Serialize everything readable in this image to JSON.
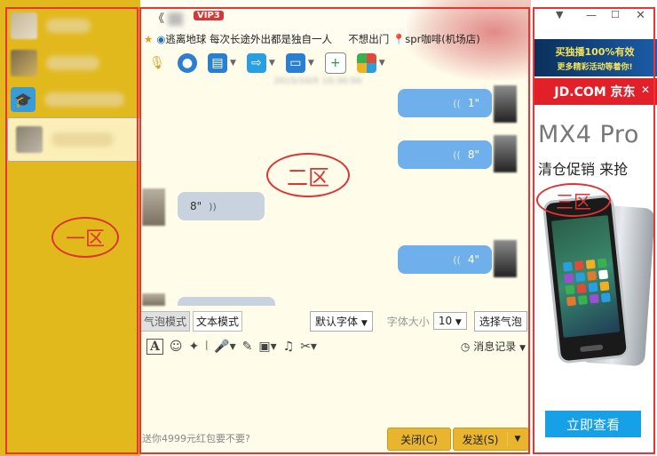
{
  "zone_labels": {
    "zone1": "一区",
    "zone2": "二区",
    "zone3": "三区"
  },
  "chat": {
    "vip_badge": "VIP3",
    "status_line": "逃离地球 每次长途外出都是独自一人",
    "status_extra": "不想出门",
    "location": "spr咖啡(机场店)",
    "messages": [
      {
        "side": "right",
        "duration": "1\""
      },
      {
        "side": "right",
        "duration": "8\""
      },
      {
        "side": "left",
        "duration": "8\""
      },
      {
        "side": "right",
        "duration": "4\""
      }
    ],
    "mode_tabs": {
      "bubble": "气泡模式",
      "text": "文本模式"
    },
    "font_select": "默认字体",
    "font_size_label": "字体大小",
    "font_size_value": "10",
    "choose_bubble": "选择气泡",
    "history": "消息记录",
    "input_hint": "送你4999元红包要不要?",
    "close_button": "关闭(C)",
    "send_button": "发送(S)"
  },
  "ad": {
    "top_banner_line1": "买独播100%有效",
    "top_banner_line2": "更多精彩活动等着你!",
    "jd_brand": "JD.COM 京东",
    "model": "MX4 Pro",
    "tagline": "清仓促销 来抢",
    "cta": "立即查看"
  },
  "colors": {
    "zone1_bg": "#e2b91d",
    "chat_bg": "#fffdea",
    "bubble_out": "#6fb0ec",
    "bubble_in": "#c9d3e0",
    "send_button": "#e9b52e",
    "jd_red": "#e2202a",
    "cta_blue": "#16a0e6",
    "annotation_red": "#dd3333"
  }
}
